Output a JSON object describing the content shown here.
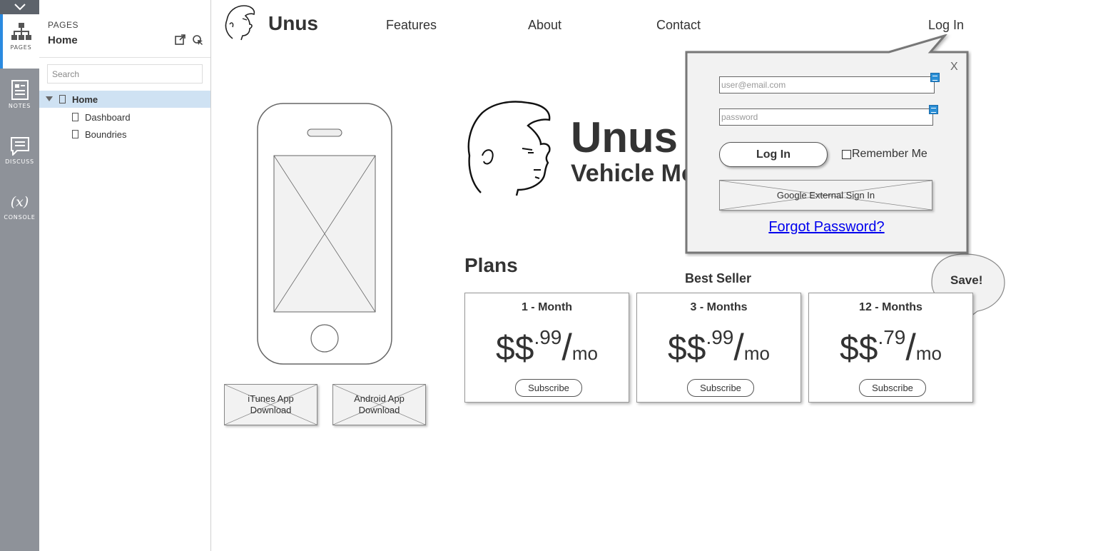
{
  "rail": {
    "items": [
      {
        "label": "PAGES",
        "icon": "sitemap-icon"
      },
      {
        "label": "NOTES",
        "icon": "notes-icon"
      },
      {
        "label": "DISCUSS",
        "icon": "discuss-icon"
      },
      {
        "label": "CONSOLE",
        "icon": "console-icon",
        "glyph": "(x)"
      }
    ]
  },
  "panel": {
    "caption": "PAGES",
    "title": "Home",
    "search_placeholder": "Search",
    "tree": [
      {
        "label": "Home"
      },
      {
        "label": "Dashboard"
      },
      {
        "label": "Boundries"
      }
    ]
  },
  "site": {
    "brand": "Unus",
    "nav": {
      "features": "Features",
      "about": "About",
      "contact": "Contact",
      "login": "Log In"
    },
    "hero": {
      "title": "Unus",
      "subtitle": "Vehicle Mo"
    },
    "app_buttons": {
      "itunes": "iTunes App Download",
      "android": "Android App Download"
    },
    "plans_heading": "Plans",
    "best_seller": "Best Seller",
    "save_badge": "Save!",
    "plans": [
      {
        "title": "1 - Month",
        "currency": "$$",
        "cents": ".99",
        "slash": "/",
        "unit": "mo",
        "button": "Subscribe"
      },
      {
        "title": "3 - Months",
        "currency": "$$",
        "cents": ".99",
        "slash": "/",
        "unit": "mo",
        "button": "Subscribe"
      },
      {
        "title": "12 - Months",
        "currency": "$$",
        "cents": ".79",
        "slash": "/",
        "unit": "mo",
        "button": "Subscribe"
      }
    ]
  },
  "login": {
    "close": "X",
    "email_placeholder": "user@email.com",
    "password_placeholder": "password",
    "submit": "Log In",
    "remember": "Remember Me",
    "google": "Google External Sign In",
    "forgot": "Forgot Password?"
  },
  "colors": {
    "rail_bg": "#8e9299",
    "active_accent": "#2a8ae0",
    "selected_row": "#cfe2f3",
    "link": "#0000ee",
    "badge": "#2b8fd6"
  }
}
